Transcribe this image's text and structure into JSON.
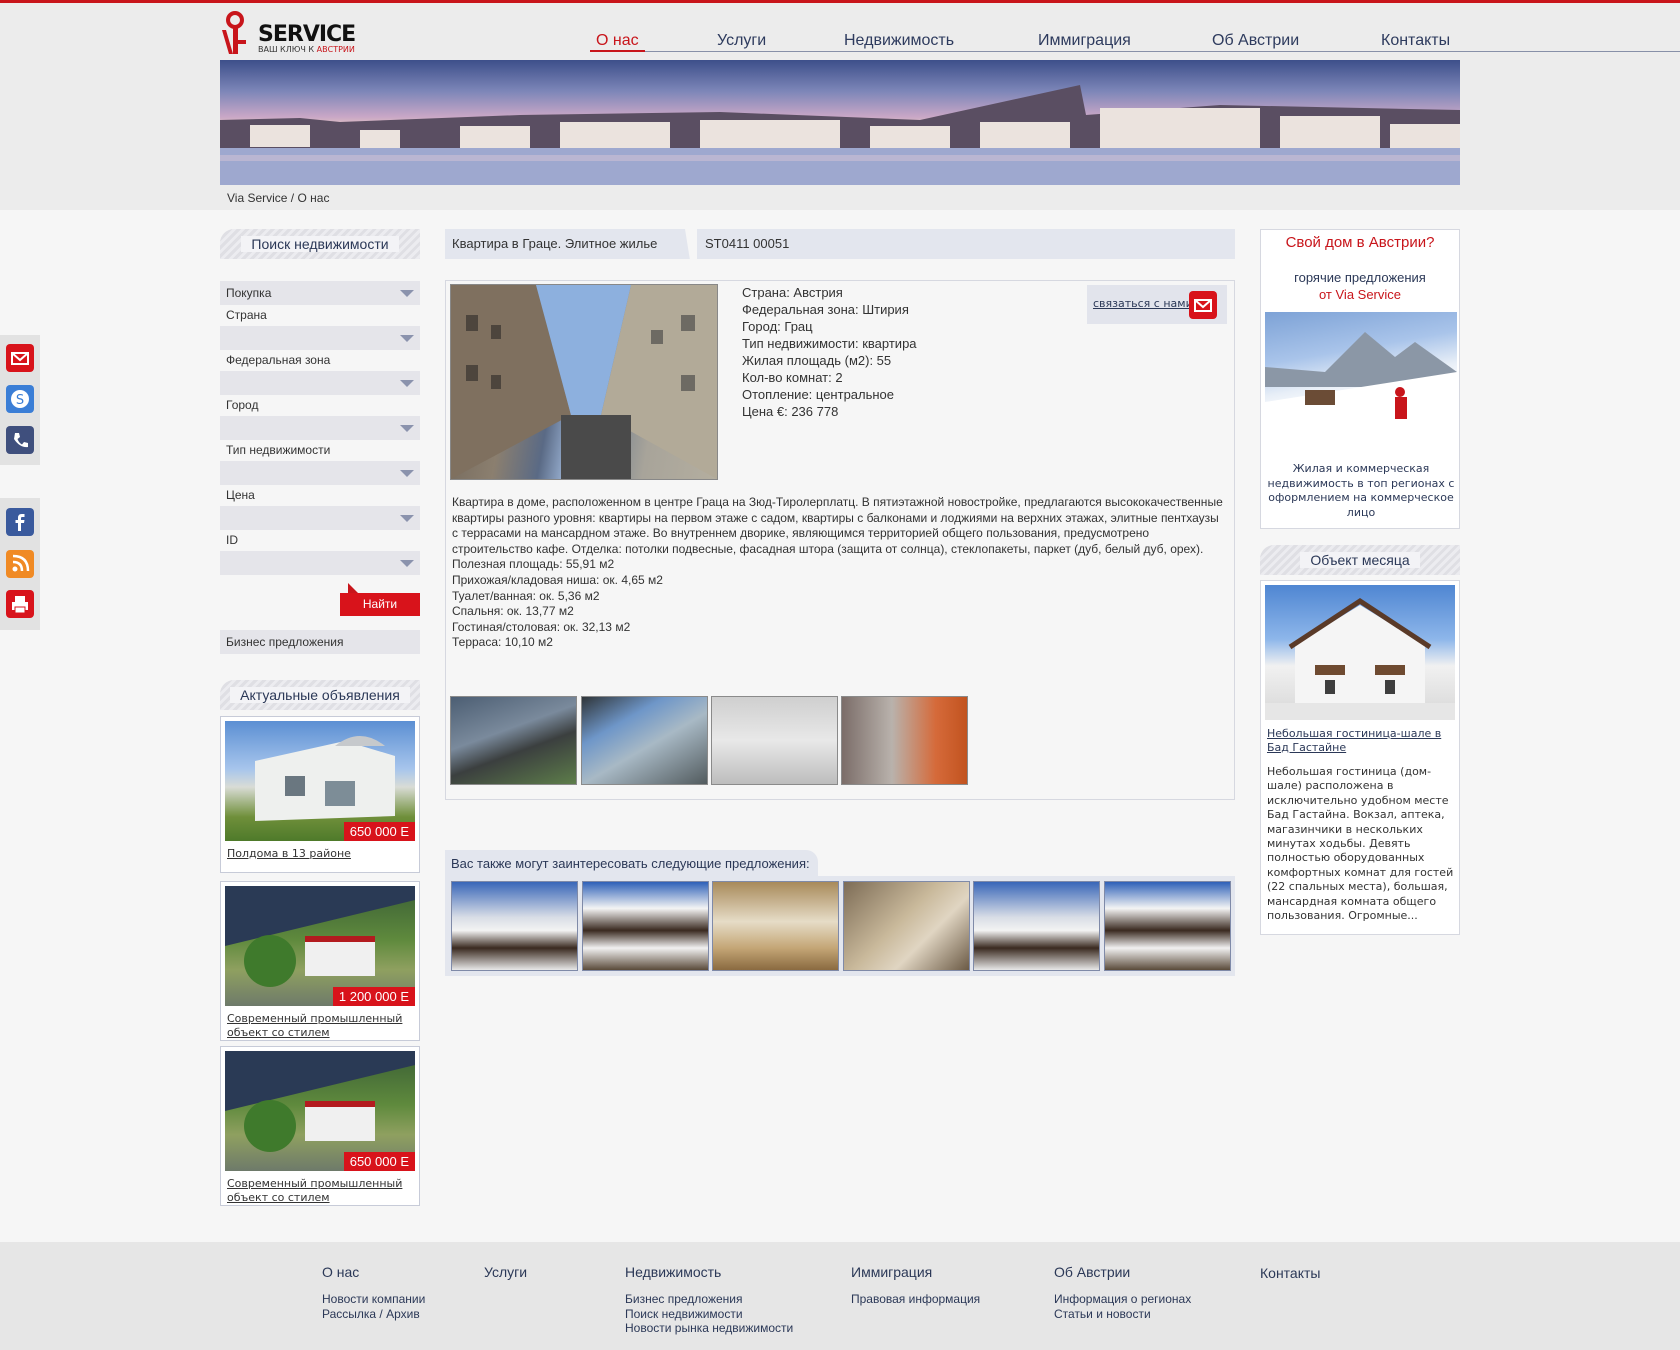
{
  "logo": {
    "name": "SERVICE",
    "tagline_a": "ВАШ КЛЮЧ К",
    "tagline_b": "АВСТРИИ"
  },
  "nav": [
    "О нас",
    "Услуги",
    "Недвижимость",
    "Иммиграция",
    "Об Австрии",
    "Контакты"
  ],
  "breadcrumb": "Via Service / О нас",
  "search": {
    "title": "Поиск недвижимости",
    "deal_type": "Покупка",
    "fields": [
      "Страна",
      "Федеральная зона",
      "Город",
      "Тип недвижимости",
      "Цена",
      "ID"
    ],
    "button": "Найти",
    "business_link": "Бизнес предложения"
  },
  "ads": {
    "title": "Актуальные объявления",
    "items": [
      {
        "price": "650 000 Е",
        "caption": "Полдома в 13 районе"
      },
      {
        "price": "1 200 000 Е",
        "caption": "Современный промышленный объект со стилем"
      },
      {
        "price": "650 000 Е",
        "caption": "Современный промышленный объект со стилем"
      }
    ]
  },
  "share_icons": [
    "mail-icon",
    "skype-icon",
    "phone-icon",
    "facebook-icon",
    "rss-icon",
    "print-icon"
  ],
  "listing": {
    "title": "Квартира в Граце. Элитное жилье",
    "id": "ST0411 00051",
    "contact": "связаться с нами",
    "props": [
      "Страна: Австрия",
      "Федеральная зона: Штирия",
      "Город: Грац",
      "Тип недвижимости: квартира",
      "Жилая площадь (м2): 55",
      "Кол-во комнат: 2",
      "Отопление: центральное",
      "Цена €: 236 778"
    ],
    "description": "Квартира в доме, расположенном в центре Граца на Зюд-Тиролерплатц.  В пятиэтажной новостройке, предлагаются высококачественные квартиры разного уровня: квартиры на первом этаже с садом, квартиры с балконами и лоджиями на верхних этажах, элитные пентхаузы с террасами на мансардном этаже. Во внутреннем дворике, являющимся территорией общего пользования, предусмотрено строительство кафе. Отделка: потолки подвесные, фасадная штора (защита от солнца), стеклопакеты, паркет (дуб, белый дуб, орех).",
    "areas": [
      "Полезная площадь: 55,91 м2",
      "Прихожая/кладовая ниша: ок. 4,65 м2",
      "Туалет/ванная: ок. 5,36 м2",
      "Спальня: ок. 13,77 м2",
      "Гостиная/столовая: ок. 32,13 м2",
      "Терраса: 10,10 м2"
    ]
  },
  "interest": {
    "label": "Вас также могут заинтересовать следующие предложения:"
  },
  "promo": {
    "title": "Свой дом в Австрии?",
    "sub1": "горячие предложения",
    "sub2": "от Via Service",
    "text": "Жилая и коммерческая недвижимость в топ регионах с оформлением на коммерческое лицо"
  },
  "object_of_month": {
    "title": "Объект месяца",
    "link": "Небольшая гостиница-шале в Бад Гастайне",
    "text": "Небольшая гостиница (дом-шале) расположена в исключительно удобном месте Бад Гастайна. Вокзал, аптека, магазинчики в нескольких минутах ходьбы.  Девять полностью оборудованных комфортных комнат для гостей (22 спальных места), большая, мансардная комната общего пользования. Огромные..."
  },
  "footer": [
    {
      "h": "О нас",
      "items": [
        "Новости компании",
        "Рассылка / Архив"
      ]
    },
    {
      "h": "Услуги",
      "items": []
    },
    {
      "h": "Недвижимость",
      "items": [
        "Бизнес предложения",
        "Поиск недвижимости",
        "Новости рынка недвижимости"
      ]
    },
    {
      "h": "Иммиграция",
      "items": [
        "Правовая информация"
      ]
    },
    {
      "h": "Об Австрии",
      "items": [
        "Информация о регионах",
        "Статьи и новости"
      ]
    },
    {
      "h": "Контакты",
      "items": []
    }
  ],
  "colors": {
    "accent": "#c8151b",
    "nav_text": "#2e3b5e"
  }
}
